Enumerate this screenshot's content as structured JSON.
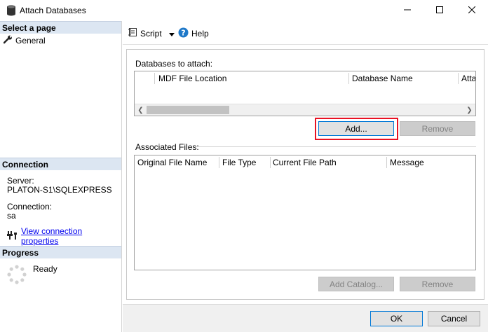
{
  "window": {
    "title": "Attach Databases",
    "icons": {
      "title": "database-icon",
      "minimize": "minimize-icon",
      "maximize": "maximize-icon",
      "close": "close-icon"
    }
  },
  "left_pane": {
    "select_page": {
      "header": "Select a page",
      "items": [
        {
          "label": "General",
          "icon": "wrench-icon"
        }
      ]
    },
    "connection": {
      "header": "Connection",
      "server_label": "Server:",
      "server_value": "PLATON-S1\\SQLEXPRESS",
      "connection_label": "Connection:",
      "connection_value": "sa",
      "link_label": "View connection properties",
      "link_icon": "connection-properties-icon"
    },
    "progress": {
      "header": "Progress",
      "status": "Ready",
      "icon": "progress-spinner-icon"
    }
  },
  "toolbar": {
    "script_label": "Script",
    "help_label": "Help",
    "icons": {
      "script": "script-icon",
      "dropdown": "dropdown-arrow-icon",
      "help": "help-icon"
    }
  },
  "databases_section": {
    "label": "Databases to attach:",
    "columns": [
      "",
      "MDF File Location",
      "Database Name",
      "Atta"
    ],
    "rows": [],
    "add_button": "Add...",
    "remove_button": "Remove"
  },
  "files_section": {
    "label": "Associated Files:",
    "columns": [
      "Original File Name",
      "File Type",
      "Current File Path",
      "Message"
    ],
    "rows": [],
    "add_catalog_button": "Add Catalog...",
    "remove_button": "Remove"
  },
  "footer": {
    "ok_button": "OK",
    "cancel_button": "Cancel"
  },
  "colors": {
    "section_header_bg": "#dce6f2",
    "link": "#0000ee",
    "highlight_border": "#e81123",
    "focus_border": "#0078d7"
  }
}
